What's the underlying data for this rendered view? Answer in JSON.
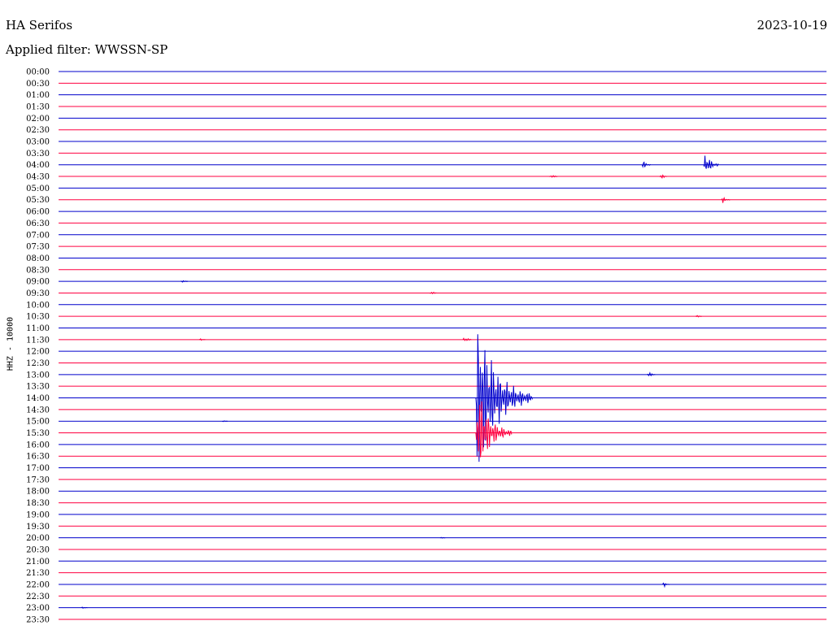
{
  "header": {
    "station": "HA Serifos",
    "date": "2023-10-19",
    "filter_label": "Applied filter:",
    "filter_value": "WWSSN-SP"
  },
  "chart_data": {
    "type": "line",
    "title": "HA Serifos",
    "subtitle": "Applied filter: WWSSN-SP",
    "date": "2023-10-19",
    "ylabel": "HHZ - 10000",
    "xlabel": "",
    "colors": {
      "even": "#0000cc",
      "odd": "#ff0040"
    },
    "categories": [
      "00:00",
      "00:30",
      "01:00",
      "01:30",
      "02:00",
      "02:30",
      "03:00",
      "03:30",
      "04:00",
      "04:30",
      "05:00",
      "05:30",
      "06:00",
      "06:30",
      "07:00",
      "07:30",
      "08:00",
      "08:30",
      "09:00",
      "09:30",
      "10:00",
      "10:30",
      "11:00",
      "11:30",
      "12:00",
      "12:30",
      "13:00",
      "13:30",
      "14:00",
      "14:30",
      "15:00",
      "15:30",
      "16:00",
      "16:30",
      "17:00",
      "17:30",
      "18:00",
      "18:30",
      "19:00",
      "19:30",
      "20:00",
      "20:30",
      "21:00",
      "21:30",
      "22:00",
      "22:30",
      "23:00",
      "23:30"
    ],
    "row_unit": "minutes",
    "row_length": 30,
    "events": [
      {
        "row": "04:00",
        "minute": 22.8,
        "amplitude": 9
      },
      {
        "row": "04:00",
        "minute": 25.2,
        "amplitude": 24
      },
      {
        "row": "04:30",
        "minute": 19.2,
        "amplitude": 6
      },
      {
        "row": "04:30",
        "minute": 23.5,
        "amplitude": 6
      },
      {
        "row": "05:30",
        "minute": 25.9,
        "amplitude": 8
      },
      {
        "row": "09:00",
        "minute": 4.8,
        "amplitude": 5
      },
      {
        "row": "09:30",
        "minute": 14.5,
        "amplitude": 5
      },
      {
        "row": "10:30",
        "minute": 24.9,
        "amplitude": 3
      },
      {
        "row": "11:30",
        "minute": 5.5,
        "amplitude": 3
      },
      {
        "row": "11:30",
        "minute": 15.8,
        "amplitude": 8
      },
      {
        "row": "13:00",
        "minute": 23.0,
        "amplitude": 7
      },
      {
        "row": "14:00",
        "minute": 16.3,
        "amplitude": 120
      },
      {
        "row": "15:00",
        "minute": 6.4,
        "amplitude": 2
      },
      {
        "row": "15:30",
        "minute": 16.3,
        "amplitude": 70
      },
      {
        "row": "20:00",
        "minute": 14.9,
        "amplitude": 2
      },
      {
        "row": "22:00",
        "minute": 23.6,
        "amplitude": 6
      },
      {
        "row": "23:00",
        "minute": 0.9,
        "amplitude": 3
      }
    ],
    "grid": false,
    "legend": "none"
  }
}
